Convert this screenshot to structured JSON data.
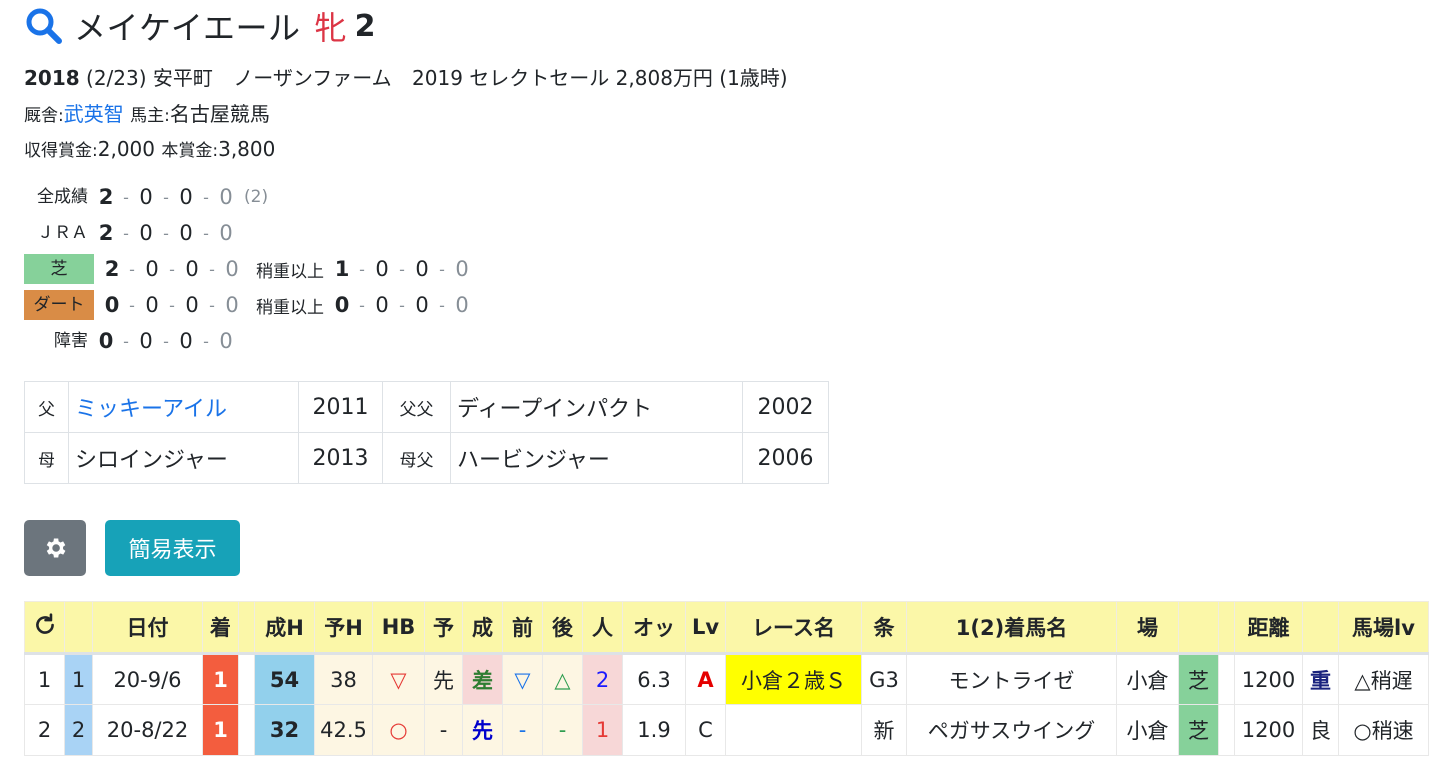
{
  "horse": {
    "name": "メイケイエール",
    "sex": "牝",
    "age": "2"
  },
  "profile": {
    "birth_year": "2018",
    "birth_date": "(2/23)",
    "birthplace": "安平町",
    "breeder": "ノーザンファーム",
    "sale": "2019 セレクトセール 2,808万円 (1歳時)",
    "stable_label": "厩舎:",
    "trainer": "武英智",
    "owner_label": "馬主:",
    "owner": "名古屋競馬",
    "earned_label": "収得賞金:",
    "earned": "2,000",
    "main_prize_label": "本賞金:",
    "main_prize": "3,800"
  },
  "records": {
    "all": {
      "label": "全成績",
      "vals": [
        "2",
        "0",
        "0",
        "0"
      ],
      "extra": "(2)"
    },
    "jra": {
      "label": "ＪＲＡ",
      "vals": [
        "2",
        "0",
        "0",
        "0"
      ]
    },
    "turf": {
      "label": "芝",
      "vals": [
        "2",
        "0",
        "0",
        "0"
      ],
      "heavy_label": "稍重以上",
      "heavy_vals": [
        "1",
        "0",
        "0",
        "0"
      ]
    },
    "dirt": {
      "label": "ダート",
      "vals": [
        "0",
        "0",
        "0",
        "0"
      ],
      "heavy_label": "稍重以上",
      "heavy_vals": [
        "0",
        "0",
        "0",
        "0"
      ]
    },
    "hurdle": {
      "label": "障害",
      "vals": [
        "0",
        "0",
        "0",
        "0"
      ]
    }
  },
  "pedigree": {
    "sire_label": "父",
    "sire": "ミッキーアイル",
    "sire_year": "2011",
    "sire_sire_label": "父父",
    "sire_sire": "ディープインパクト",
    "sire_sire_year": "2002",
    "dam_label": "母",
    "dam": "シロインジャー",
    "dam_year": "2013",
    "dam_sire_label": "母父",
    "dam_sire": "ハービンジャー",
    "dam_sire_year": "2006"
  },
  "buttons": {
    "settings_icon": "gear-icon",
    "simple_view": "簡易表示"
  },
  "race_table": {
    "refresh_icon": "refresh-icon",
    "headers": [
      "",
      "",
      "日付",
      "着",
      "",
      "成H",
      "予H",
      "HB",
      "予",
      "成",
      "前",
      "後",
      "人",
      "オッ",
      "Lv",
      "レース名",
      "条",
      "1(2)着馬名",
      "場",
      "",
      "",
      "距離",
      "",
      "馬場lv"
    ],
    "rows": [
      {
        "no": "1",
        "idx": "1",
        "date": "20-9/6",
        "finish": "1",
        "seih": "54",
        "yoh": "38",
        "hb": "▽",
        "yo": "先",
        "sei": "差",
        "mae": "▽",
        "ato": "△",
        "pop": "2",
        "odds": "6.3",
        "lv": "A",
        "race": "小倉２歳Ｓ",
        "cond": "G3",
        "horse": "モントライゼ",
        "track": "小倉",
        "surface": "芝",
        "dist": "1200",
        "going": "重",
        "going_lv": "△稍遅"
      },
      {
        "no": "2",
        "idx": "2",
        "date": "20-8/22",
        "finish": "1",
        "seih": "32",
        "yoh": "42.5",
        "hb": "○",
        "yo": "-",
        "sei": "先",
        "mae": "-",
        "ato": "-",
        "pop": "1",
        "odds": "1.9",
        "lv": "C",
        "race": "",
        "cond": "新",
        "horse": "ペガサスウイング",
        "track": "小倉",
        "surface": "芝",
        "dist": "1200",
        "going": "良",
        "going_lv": "○稍速"
      }
    ]
  },
  "colors": {
    "accent": "#17a2b8",
    "sex": "#dc3545",
    "link": "#1a73e8",
    "header_bg": "#fbf7a8",
    "turf": "#86d19a",
    "dirt": "#d98c46",
    "win": "#f35d3e"
  }
}
